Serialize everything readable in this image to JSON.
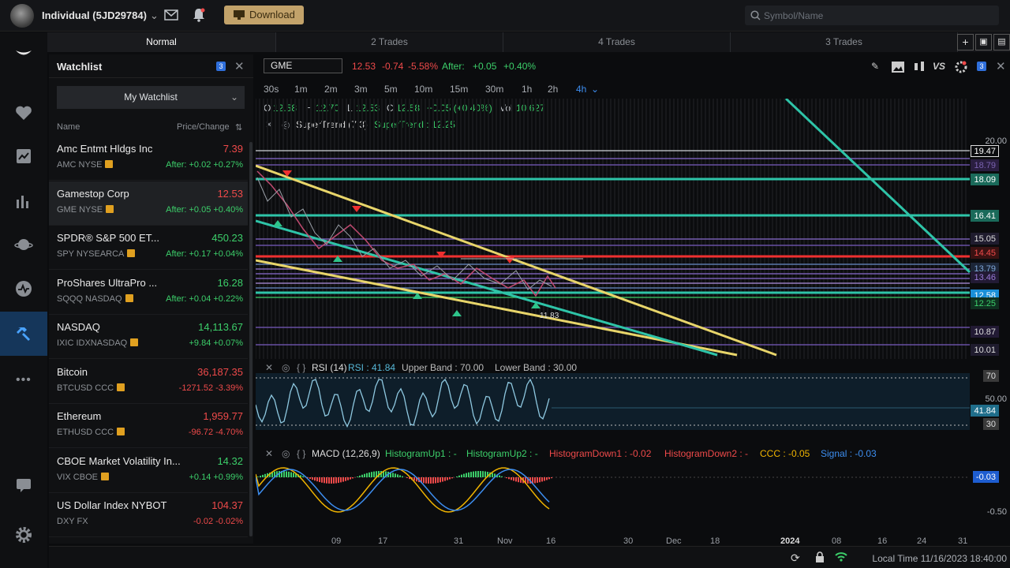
{
  "account": {
    "name": "Individual (5JD29784)"
  },
  "download_label": "Download",
  "search_placeholder": "Symbol/Name",
  "tabs": [
    "Normal",
    "2 Trades",
    "4 Trades",
    "3 Trades"
  ],
  "watchlist": {
    "title": "Watchlist",
    "badge": "3",
    "selector": "My Watchlist",
    "col_name": "Name",
    "col_price": "Price/Change",
    "items": [
      {
        "name": "Amc Entmt Hldgs Inc",
        "ex": "AMC NYSE",
        "price": "7.39",
        "change": "After: +0.02 +0.27%"
      },
      {
        "name": "Gamestop Corp",
        "ex": "GME NYSE",
        "price": "12.53",
        "change": "After: +0.05 +0.40%"
      },
      {
        "name": "SPDR® S&P 500 ET...",
        "ex": "SPY NYSEARCA",
        "price": "450.23",
        "change": "After: +0.17 +0.04%"
      },
      {
        "name": "ProShares UltraPro ...",
        "ex": "SQQQ NASDAQ",
        "price": "16.28",
        "change": "After: +0.04 +0.22%"
      },
      {
        "name": "NASDAQ",
        "ex": "IXIC IDXNASDAQ",
        "price": "14,113.67",
        "change": "+9.84 +0.07%"
      },
      {
        "name": "Bitcoin",
        "ex": "BTCUSD CCC",
        "price": "36,187.35",
        "change": "-1271.52 -3.39%"
      },
      {
        "name": "Ethereum",
        "ex": "ETHUSD CCC",
        "price": "1,959.77",
        "change": "-96.72 -4.70%"
      },
      {
        "name": "CBOE Market Volatility In...",
        "ex": "VIX CBOE",
        "price": "14.32",
        "change": "+0.14 +0.99%"
      },
      {
        "name": "US Dollar Index NYBOT",
        "ex": "DXY FX",
        "price": "104.37",
        "change": "-0.02 -0.02%"
      }
    ]
  },
  "chart": {
    "symbol": "GME",
    "last": "12.53",
    "chg": "-0.74",
    "chgpct": "-5.58%",
    "after_label": "After:",
    "after_chg": "+0.05",
    "after_pct": "+0.40%",
    "badge": "3",
    "timeframes": [
      "30s",
      "1m",
      "2m",
      "3m",
      "5m",
      "10m",
      "15m",
      "30m",
      "1h",
      "2h",
      "4h"
    ],
    "ohlc": {
      "o_label": "O",
      "o": "12.58",
      "h_label": "H",
      "h": "12.70",
      "l_label": "L",
      "l": "12.53",
      "c_label": "C",
      "c": "12.58",
      "chg": "+0.05 (+0.40%)",
      "vol_label": "Vol",
      "vol": "10,627"
    },
    "supertrend": {
      "name": "SuperTrend (7,3)",
      "value": "SuperTrend : 12.25"
    },
    "rsi": {
      "name": "RSI (14)",
      "value": "RSI : 41.84",
      "upper": "Upper Band : 70.00",
      "lower": "Lower Band : 30.00",
      "axis": [
        "70",
        "50.00",
        "41.84",
        "30"
      ]
    },
    "macd": {
      "name": "MACD (12,26,9)",
      "hu1": "HistogramUp1 : -",
      "hu2": "HistogramUp2 : -",
      "hd1": "HistogramDown1 : -0.02",
      "hd2": "HistogramDown2 : -",
      "ccc": "CCC : -0.05",
      "signal": "Signal : -0.03",
      "axis": [
        "-0.03",
        "-0.50"
      ]
    },
    "price_axis": [
      "20.00",
      "19.47",
      "18.79",
      "18.09",
      "16.41",
      "15.05",
      "14.45",
      "13.79",
      "13.46",
      "12.58",
      "12.25",
      "10.87",
      "10.01"
    ],
    "low_label": "11.83",
    "x_labels": [
      "09",
      "17",
      "31",
      "Nov",
      "16",
      "30",
      "Dec",
      "18",
      "2024",
      "08",
      "16",
      "24",
      "31"
    ]
  },
  "colors": {
    "accent": "#3d8ef0",
    "up": "#3ccf6a",
    "down": "#ef4a4a",
    "yellow_line": "#e8d56a",
    "teal_line": "#2ec4a8"
  },
  "status": {
    "local_time": "Local Time 11/16/2023 18:40:00"
  }
}
